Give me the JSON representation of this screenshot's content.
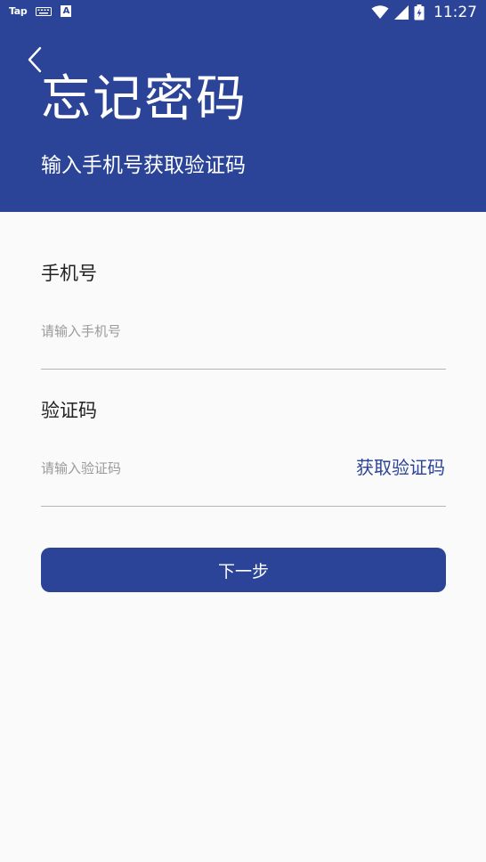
{
  "status_bar": {
    "app_badge": "Tap",
    "keyboard_icon": "keyboard-icon",
    "notify_letter": "A",
    "time": "11:27"
  },
  "header": {
    "title": "忘记密码",
    "subtitle": "输入手机号获取验证码",
    "background_color": "#2b4497"
  },
  "form": {
    "phone": {
      "label": "手机号",
      "value": "",
      "placeholder": "请输入手机号"
    },
    "code": {
      "label": "验证码",
      "value": "",
      "placeholder": "请输入验证码",
      "get_code_label": "获取验证码"
    }
  },
  "actions": {
    "next_label": "下一步",
    "accent_color": "#2b4497"
  }
}
